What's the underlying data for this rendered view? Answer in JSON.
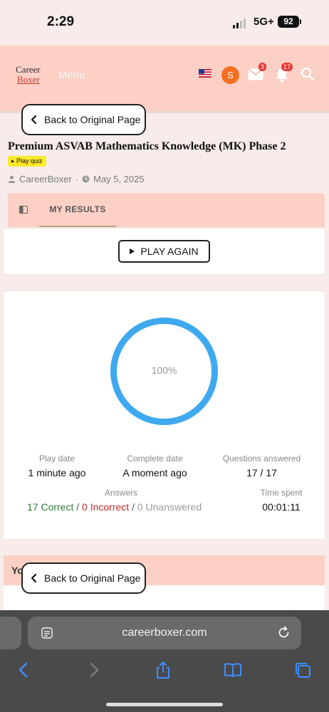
{
  "status_bar": {
    "time": "2:29",
    "network": "5G+",
    "battery": "92"
  },
  "header": {
    "logo_line1": "Career",
    "logo_line2": "Boxer",
    "menu_label": "Menu",
    "avatar_letter": "S",
    "mail_badge": "3",
    "notif_badge": "17"
  },
  "back_button": {
    "label": "Back to Original Page"
  },
  "quiz": {
    "title": "Premium ASVAB Mathematics Knowledge (MK) Phase 2",
    "tag": "Play quiz",
    "author": "CareerBoxer",
    "separator": "·",
    "date": "May 5, 2025"
  },
  "tabs": {
    "results_label": "MY RESULTS"
  },
  "play_again_label": "PLAY AGAIN",
  "results": {
    "score_percent_text": "100%",
    "score_fraction": 1.0,
    "ring_color": "#3fa9f0",
    "play_date_label": "Play date",
    "play_date_value": "1 minute ago",
    "complete_date_label": "Complete date",
    "complete_date_value": "A moment ago",
    "questions_label": "Questions answered",
    "questions_value": "17 / 17",
    "answers_label": "Answers",
    "correct_text": "17 Correct",
    "incorrect_text": "0 Incorrect",
    "unanswered_text": "0 Unanswered",
    "slash": "/",
    "time_label": "Time spent",
    "time_value": "00:01:11"
  },
  "bottom_card": {
    "heading_partial": "Yo"
  },
  "browser": {
    "url": "careerboxer.com"
  },
  "colors": {
    "header_bg": "#fdd0c5",
    "correct": "#2e7d32",
    "incorrect": "#c62828",
    "accent_blue": "#3fa9f0"
  }
}
